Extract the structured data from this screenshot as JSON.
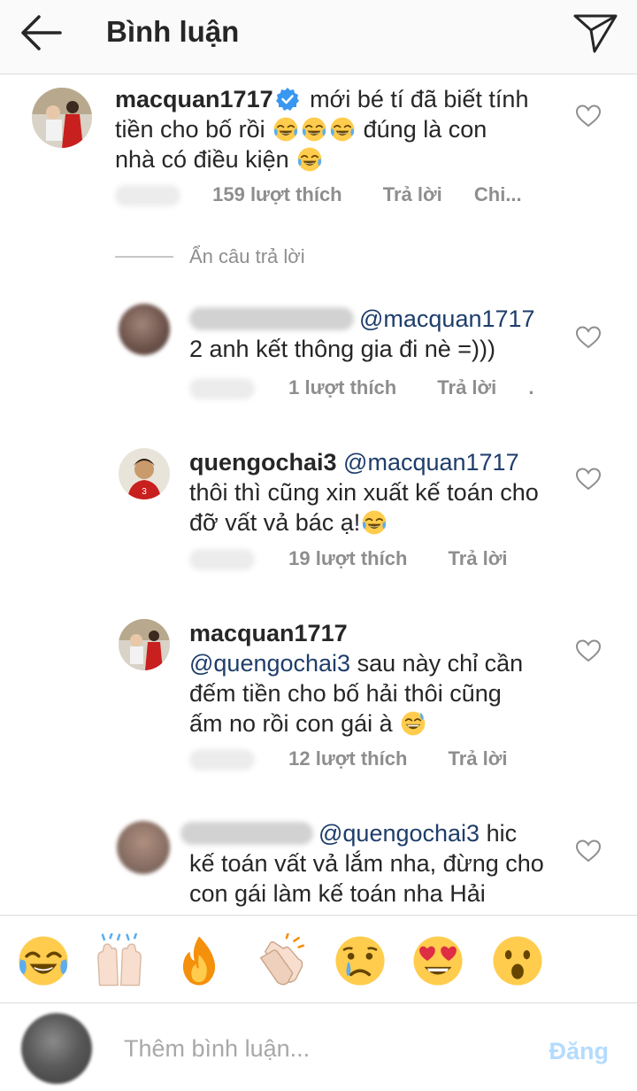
{
  "header": {
    "title": "Bình luận"
  },
  "comments": [
    {
      "username": "macquan1717",
      "verified": true,
      "lines": [
        [
          "mới bé tí đã biết tính"
        ],
        [
          "tiền cho bố rồi",
          "[joy][joy][joy]",
          "đúng là con"
        ],
        [
          "nhà có điều kiện",
          "[joy]"
        ]
      ],
      "text": "mới bé tí đã biết tính tiền cho bố rồi 😂😂😂 đúng là con nhà có điều kiện 😂",
      "likes": "159 lượt thích",
      "reply": "Trả lời",
      "extra": "Chi..."
    }
  ],
  "hide_replies": "Ẩn câu trả lời",
  "replies": [
    {
      "username_blurred": true,
      "mention": "@macquan1717",
      "text": "2 anh kết thông gia đi nè =)))",
      "likes": "1 lượt thích",
      "reply": "Trả lời",
      "extra": "."
    },
    {
      "username": "quengochai3",
      "mention": "@macquan1717",
      "text": "thôi thì cũng xin xuất kế toán cho đỡ vất vả bác ạ!😂",
      "line1": "thôi thì cũng xin xuất kế toán cho",
      "line2": "đỡ vất vả bác ạ!",
      "likes": "19 lượt thích",
      "reply": "Trả lời"
    },
    {
      "username": "macquan1717",
      "mention": "@quengochai3",
      "text": "sau này chỉ cần đếm tiền cho bố hải thôi cũng ấm no rồi con gái à 😅",
      "line1": "sau này chỉ cần",
      "line2": "đếm tiền cho bố hải thôi cũng",
      "line3": "ấm no rồi con gái à",
      "likes": "12 lượt thích",
      "reply": "Trả lời"
    },
    {
      "username_blurred": true,
      "mention": "@quengochai3",
      "text": "hic kế toán vất vả lắm nha, đừng cho con gái làm kế toán nha Hải",
      "line1": "hic",
      "line2": "kế toán vất vả lắm nha, đừng cho",
      "line3": "con gái làm kế toán nha Hải"
    }
  ],
  "emoji_bar": [
    {
      "name": "joy-emoji",
      "char": "😂"
    },
    {
      "name": "raising-hands-emoji",
      "char": "🙌"
    },
    {
      "name": "fire-emoji",
      "char": "🔥"
    },
    {
      "name": "clapping-hands-emoji",
      "char": "👏"
    },
    {
      "name": "crying-face-emoji",
      "char": "😢"
    },
    {
      "name": "heart-eyes-emoji",
      "char": "😍"
    },
    {
      "name": "surprised-emoji",
      "char": "😮"
    }
  ],
  "composer": {
    "placeholder": "Thêm bình luận...",
    "post_label": "Đăng"
  },
  "colors": {
    "text": "#262626",
    "meta": "#8e8e8e",
    "mention": "#1e3d6b",
    "verified": "#3897f0",
    "post_disabled": "#b3dbff",
    "header_bg": "#fafafa"
  }
}
